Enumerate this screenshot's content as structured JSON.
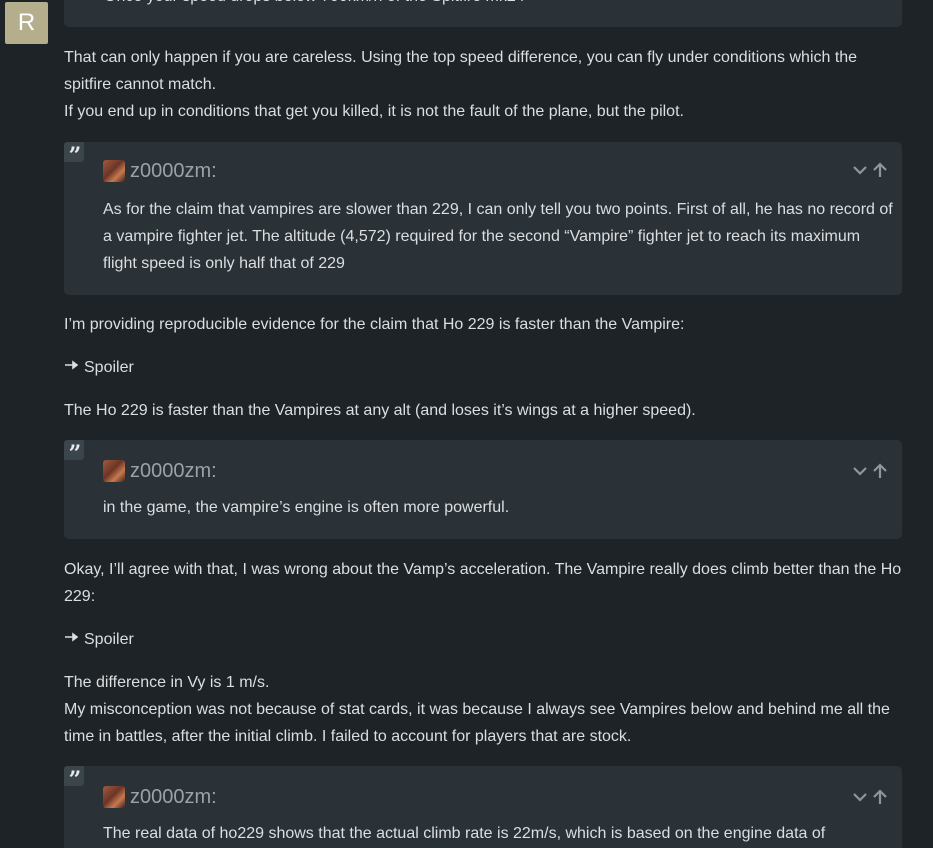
{
  "sidebar": {
    "avatar_letter": "R",
    "avatar_color": "#b5ae8d"
  },
  "post": {
    "top_quote_partial": "Once your speed drops below 700km/h of the Spitfire mk24",
    "p1": "That can only happen if you are careless. Using the top speed difference, you can fly under conditions which the spitfire cannot match.",
    "p2": "If you end up in conditions that get you killed, it is not the fault of the plane, but the pilot.",
    "quote1": {
      "user": "z0000zm:",
      "body": "As for the claim that vampires are slower than 229, I can only tell you two points. First of all, he has no record of a vampire fighter jet. The altitude (4,572) required for the second “Vampire” fighter jet to reach its maximum flight speed is only half that of 229"
    },
    "p3": "I’m providing reproducible evidence for the claim that Ho 229 is faster than the Vampire:",
    "spoiler1": "Spoiler",
    "p4": "The Ho 229 is faster than the Vampires at any alt (and loses it’s wings at a higher speed).",
    "quote2": {
      "user": "z0000zm:",
      "body": "in the game, the vampire’s engine is often more powerful."
    },
    "p5": "Okay, I’ll agree with that, I was wrong about the Vamp’s acceleration. The Vampire really does climb better than the Ho 229:",
    "spoiler2": "Spoiler",
    "p6": "The difference in Vy is 1 m/s.",
    "p7": "My misconception was not because of stat cards, it was because I always see Vampires below and behind me all the time in battles, after the initial climb. I failed to account for players that are stock.",
    "quote3": {
      "user": "z0000zm:",
      "body": "The real data of ho229 shows that the actual climb rate is 22m/s, which is based on the engine data of"
    }
  },
  "icons": {
    "quote": "quote-mark-icon",
    "expand": "chevron-down-icon",
    "jump": "arrow-up-icon",
    "spoiler": "spoiler-arrow-icon"
  },
  "colors": {
    "background": "#1d2327",
    "quote_background": "#2a3237",
    "text": "#dcdee0",
    "quote_username": "#9aa3a9"
  }
}
